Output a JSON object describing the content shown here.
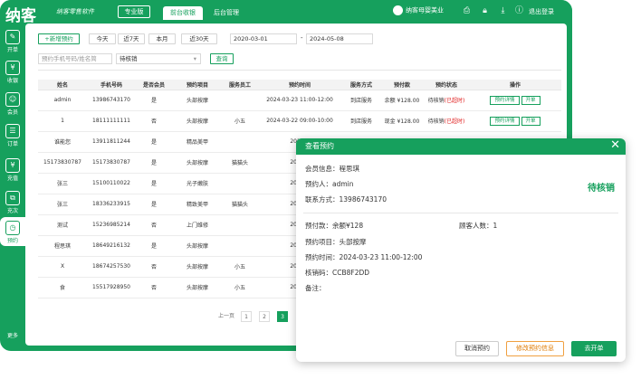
{
  "app": {
    "logo": "纳客",
    "slogan": "纳客零售软件",
    "version_badge": "专业版"
  },
  "top_tabs": [
    {
      "label": "前台收银",
      "active": true
    },
    {
      "label": "后台管理",
      "active": false
    }
  ],
  "user": {
    "name": "纳客母婴美业"
  },
  "logout": "退出登录",
  "sidebar": [
    {
      "label": "开单",
      "icon": "edit-icon",
      "glyph": "✎",
      "active": false
    },
    {
      "label": "收银",
      "icon": "cashier-icon",
      "glyph": "¥",
      "active": false
    },
    {
      "label": "会员",
      "icon": "member-icon",
      "glyph": "☺",
      "active": false
    },
    {
      "label": "订单",
      "icon": "order-icon",
      "glyph": "☰",
      "active": false
    },
    {
      "label": "充值",
      "icon": "recharge-icon",
      "glyph": "¥",
      "active": false
    },
    {
      "label": "充次",
      "icon": "count-icon",
      "glyph": "⧉",
      "active": false
    },
    {
      "label": "预约",
      "icon": "appointment-icon",
      "glyph": "◷",
      "active": true
    },
    {
      "label": "更多",
      "icon": "more-icon",
      "glyph": "",
      "active": false
    }
  ],
  "toolbar": {
    "new_btn": "+新增预约",
    "quick_dates": [
      "今天",
      "近7天",
      "本月",
      "近30天"
    ],
    "date_start": "2020-03-01",
    "date_sep": "-",
    "date_end": "2024-05-08",
    "search_placeholder": "预约手机号码/姓名简",
    "status_select": "待核销",
    "query_btn": "查询"
  },
  "table": {
    "headers": [
      "姓名",
      "手机号码",
      "是否会员",
      "预约项目",
      "服务员工",
      "预约时间",
      "服务方式",
      "预付款",
      "预约状态",
      "操作"
    ],
    "rows": [
      {
        "name": "admin",
        "phone": "13986743170",
        "member": "是",
        "item": "头部按摩",
        "staff": "",
        "time": "2024-03-23 11:00-12:00",
        "method": "到店服务",
        "prepay": "余额 ¥128.00",
        "status": "待核销",
        "status_extra": "(已超时)",
        "op1": "预约详情",
        "op2": "开单"
      },
      {
        "name": "1",
        "phone": "18111111111",
        "member": "否",
        "item": "头部按摩",
        "staff": "小五",
        "time": "2024-03-22 09:00-10:00",
        "method": "到店服务",
        "prepay": "现金 ¥128.00",
        "status": "待核销",
        "status_extra": "(已超时)",
        "op1": "预约详情",
        "op2": "开单"
      },
      {
        "name": "谁能您",
        "phone": "13911811244",
        "member": "是",
        "item": "精品美甲",
        "staff": "",
        "time": "2024-0",
        "method": "",
        "prepay": "",
        "status": "",
        "status_extra": "",
        "op1": "",
        "op2": ""
      },
      {
        "name": "15173830787",
        "phone": "15173830787",
        "member": "是",
        "item": "头部按摩",
        "staff": "猫猫头",
        "time": "2024-0",
        "method": "",
        "prepay": "",
        "status": "",
        "status_extra": "",
        "op1": "",
        "op2": ""
      },
      {
        "name": "张三",
        "phone": "15100110022",
        "member": "是",
        "item": "光子嫩肤",
        "staff": "",
        "time": "2024-0",
        "method": "",
        "prepay": "",
        "status": "",
        "status_extra": "",
        "op1": "",
        "op2": ""
      },
      {
        "name": "张三",
        "phone": "18336233915",
        "member": "是",
        "item": "精致美甲",
        "staff": "猫猫头",
        "time": "2024-0",
        "method": "",
        "prepay": "",
        "status": "",
        "status_extra": "",
        "op1": "",
        "op2": ""
      },
      {
        "name": "测试",
        "phone": "15236985214",
        "member": "否",
        "item": "上门维修",
        "staff": "",
        "time": "2024-0",
        "method": "",
        "prepay": "",
        "status": "",
        "status_extra": "",
        "op1": "",
        "op2": ""
      },
      {
        "name": "程思琪",
        "phone": "18649216132",
        "member": "是",
        "item": "头部按摩",
        "staff": "",
        "time": "2024-0",
        "method": "",
        "prepay": "",
        "status": "",
        "status_extra": "",
        "op1": "",
        "op2": ""
      },
      {
        "name": "X",
        "phone": "18674257530",
        "member": "否",
        "item": "头部按摩",
        "staff": "小五",
        "time": "2024-0",
        "method": "",
        "prepay": "",
        "status": "",
        "status_extra": "",
        "op1": "",
        "op2": ""
      },
      {
        "name": "食",
        "phone": "15517928950",
        "member": "否",
        "item": "头部按摩",
        "staff": "小五",
        "time": "2024-0",
        "method": "",
        "prepay": "",
        "status": "",
        "status_extra": "",
        "op1": "",
        "op2": ""
      }
    ]
  },
  "pager": {
    "prev": "上一页",
    "pages": [
      "1",
      "2",
      "3"
    ],
    "current": "3"
  },
  "modal": {
    "title": "查看预约",
    "member_info": "会员信息：程思琪",
    "booker": "预约人：admin",
    "contact": "联系方式：13986743170",
    "status": "待核销",
    "prepay": "预付款：余额¥128",
    "guests": "顾客人数：1",
    "item": "预约项目：头部按摩",
    "time": "预约时间：2024-03-23 11:00-12:00",
    "code": "核销码：CCB8F2DD",
    "remark": "备注：",
    "btn_cancel": "取消预约",
    "btn_edit": "修改预约信息",
    "btn_open": "去开单"
  }
}
